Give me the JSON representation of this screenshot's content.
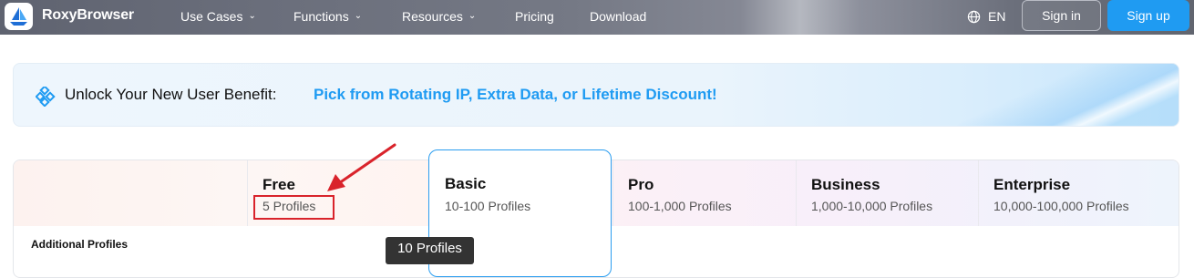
{
  "nav": {
    "brand": "RoxyBrowser",
    "items": [
      {
        "label": "Use Cases",
        "dropdown": true
      },
      {
        "label": "Functions",
        "dropdown": true
      },
      {
        "label": "Resources",
        "dropdown": true
      },
      {
        "label": "Pricing",
        "dropdown": false
      },
      {
        "label": "Download",
        "dropdown": false
      }
    ],
    "language": "EN",
    "signin_label": "Sign in",
    "signup_label": "Sign up"
  },
  "banner": {
    "lead": "Unlock Your New User Benefit:",
    "highlight": "Pick from Rotating IP, Extra Data, or Lifetime Discount!"
  },
  "plans": [
    {
      "name": "Free",
      "profiles": "5 Profiles"
    },
    {
      "name": "Basic",
      "profiles": "10-100 Profiles"
    },
    {
      "name": "Pro",
      "profiles": "100-1,000 Profiles"
    },
    {
      "name": "Business",
      "profiles": "1,000-10,000 Profiles"
    },
    {
      "name": "Enterprise",
      "profiles": "10,000-100,000 Profiles"
    }
  ],
  "rows": {
    "additional_profiles": "Additional Profiles"
  },
  "tooltip": "10 Profiles",
  "colors": {
    "accent": "#1f9bf2",
    "annotation": "#d9232b"
  },
  "icons": {
    "logo": "sail-boat-logo-icon",
    "language": "globe-icon",
    "banner": "diamond-grid-icon",
    "dropdown": "chevron-down-icon"
  }
}
